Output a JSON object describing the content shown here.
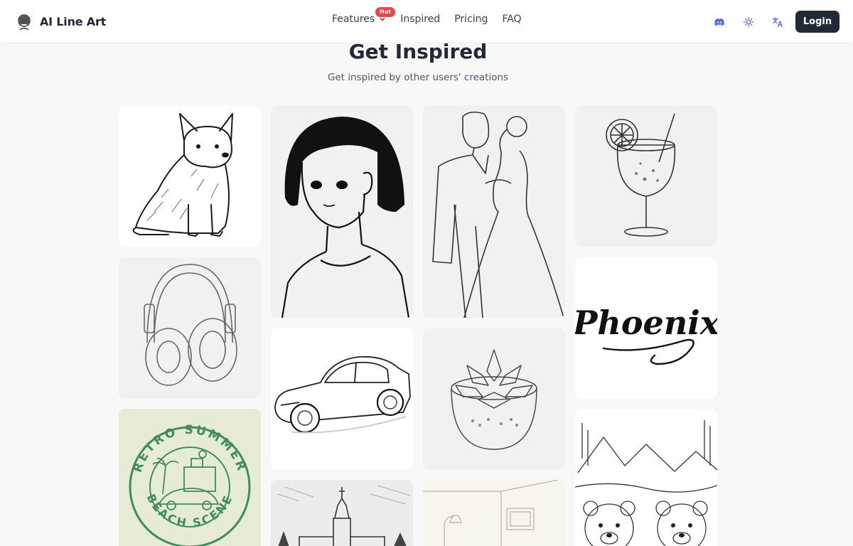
{
  "header": {
    "brand": "AI Line Art",
    "nav": {
      "features": "Features",
      "hot_badge": "Hot",
      "inspired": "Inspired",
      "pricing": "Pricing",
      "faq": "FAQ"
    },
    "icons": [
      "discord-icon",
      "sun-icon",
      "translate-icon"
    ],
    "login": "Login"
  },
  "main": {
    "title": "Get Inspired",
    "subtitle": "Get inspired by other users' creations"
  },
  "gallery": {
    "phoenix_text": "Phoenix",
    "retro_top": "RETRO SUMMER",
    "retro_bottom": "BEACH SCENE",
    "items": [
      "corgi",
      "headphones",
      "retro-summer-badge",
      "girl-portrait",
      "sports-car",
      "church",
      "wedding-couple",
      "succulent-pot",
      "room-interior",
      "cocktail-glass",
      "phoenix-lettering",
      "mountain-bears"
    ]
  },
  "colors": {
    "brand_dark": "#1f2937",
    "hot_red": "#ef4444",
    "accent_blue": "#4f6bed",
    "badge_green": "#3f8d5f",
    "badge_bg": "#e5ecd3"
  }
}
